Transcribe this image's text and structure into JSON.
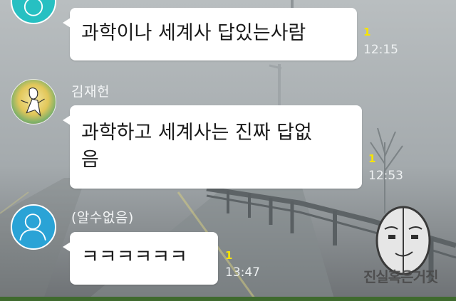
{
  "messages": [
    {
      "sender": "",
      "text": "과학이나 세계사 답있는사람",
      "unread": "1",
      "time": "12:15"
    },
    {
      "sender": "김재헌",
      "text_lines": [
        "과학하고 세계사는 진짜 답없",
        "음"
      ],
      "unread": "1",
      "time": "12:53"
    },
    {
      "sender": "(알수없음)",
      "text": "ㅋㅋㅋㅋㅋㅋ",
      "unread": "1",
      "time": "13:47"
    }
  ],
  "watermark": {
    "text": "진실혹은거짓"
  },
  "icons": {
    "avatar_default": "default-profile-silhouette-icon",
    "avatar_art": "profile-illustration-avatar"
  },
  "colors": {
    "bubble": "#ffffff",
    "unread": "#f7e400",
    "time": "#eef1f2",
    "default_avatar": "#2aa3d6",
    "teal_avatar": "#27c0c2"
  }
}
